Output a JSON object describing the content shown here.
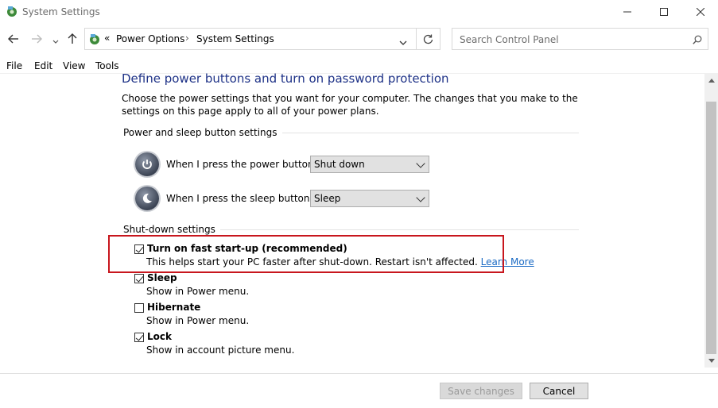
{
  "window": {
    "title": "System Settings",
    "controls": [
      "minimize",
      "maximize",
      "close"
    ]
  },
  "nav": {
    "breadcrumb": [
      "Power Options",
      "System Settings"
    ],
    "breadcrumb_prefix": "«",
    "breadcrumb_separator": "›",
    "search_placeholder": "Search Control Panel"
  },
  "menu": [
    "File",
    "Edit",
    "View",
    "Tools"
  ],
  "content": {
    "heading": "Define power buttons and turn on password protection",
    "description": "Choose the power settings that you want for your computer. The changes that you make to the settings on this page apply to all of your power plans.",
    "power_group": {
      "title": "Power and sleep button settings",
      "rows": [
        {
          "label": "When I press the power button:",
          "value": "Shut down"
        },
        {
          "label": "When I press the sleep button:",
          "value": "Sleep"
        }
      ]
    },
    "shutdown_group": {
      "title": "Shut-down settings",
      "items": [
        {
          "label": "Turn on fast start-up (recommended)",
          "description": "This helps start your PC faster after shut-down. Restart isn't affected.",
          "link": "Learn More",
          "checked": true
        },
        {
          "label": "Sleep",
          "description": "Show in Power menu.",
          "checked": true
        },
        {
          "label": "Hibernate",
          "description": "Show in Power menu.",
          "checked": false
        },
        {
          "label": "Lock",
          "description": "Show in account picture menu.",
          "checked": true
        }
      ]
    }
  },
  "footer": {
    "save_label": "Save changes",
    "cancel_label": "Cancel"
  },
  "colors": {
    "heading": "#1e3287",
    "highlight": "#c8161d",
    "link": "#1a6ac4"
  }
}
